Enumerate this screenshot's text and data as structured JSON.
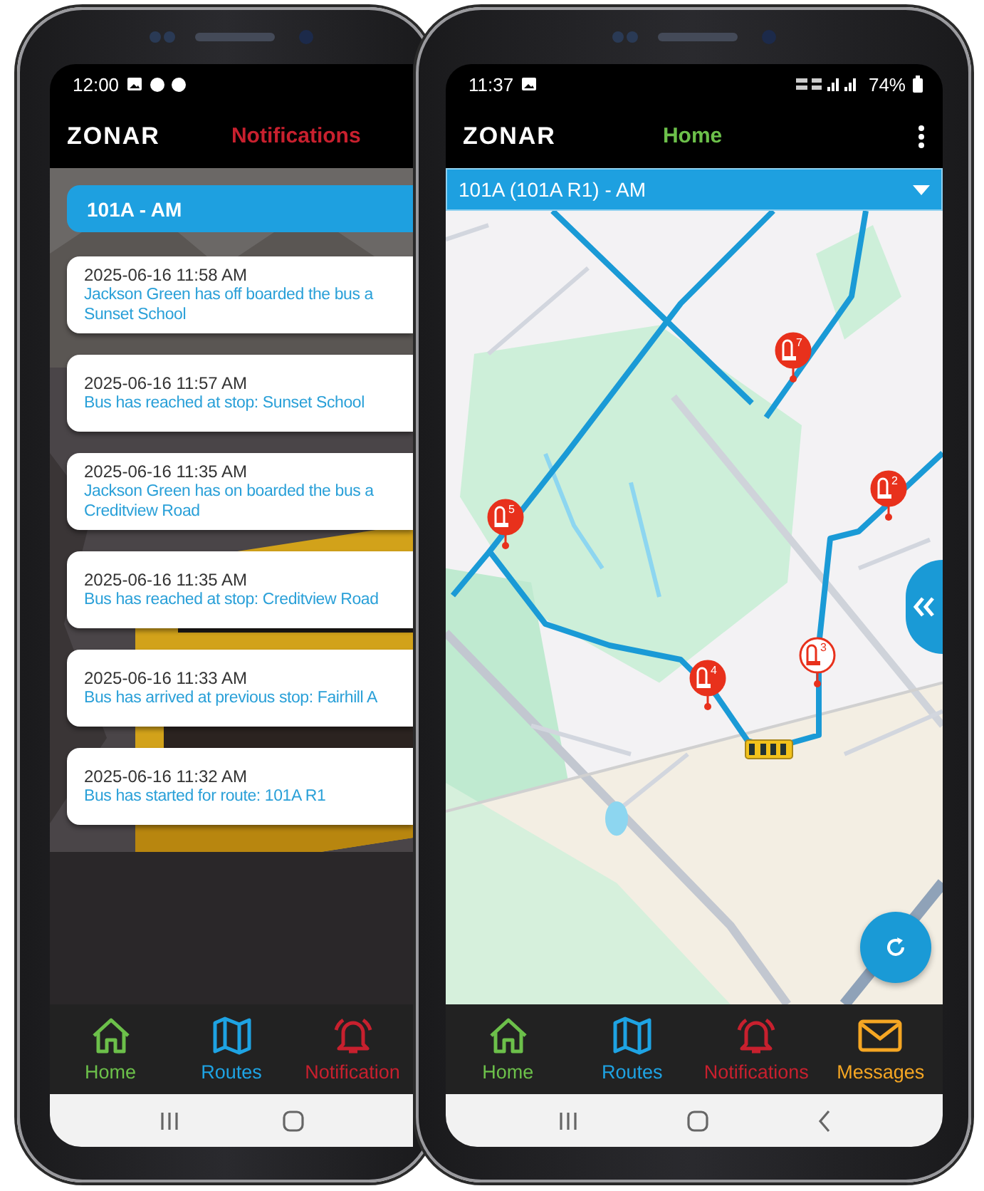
{
  "notifications_phone": {
    "status_bar": {
      "time": "12:00"
    },
    "app_bar": {
      "logo": "ZONAR",
      "title": "Notifications"
    },
    "route_header": "101A - AM",
    "notifications": [
      {
        "time": "2025-06-16 11:58 AM",
        "message": "Jackson Green has off boarded the bus a Sunset School"
      },
      {
        "time": "2025-06-16 11:57 AM",
        "message": "Bus has reached at stop: Sunset School"
      },
      {
        "time": "2025-06-16 11:35 AM",
        "message": "Jackson Green has on boarded the bus a Creditview Road"
      },
      {
        "time": "2025-06-16 11:35 AM",
        "message": "Bus has reached at stop: Creditview Road"
      },
      {
        "time": "2025-06-16 11:33 AM",
        "message": "Bus has arrived at previous stop: Fairhill A"
      },
      {
        "time": "2025-06-16 11:32 AM",
        "message": "Bus has started for route: 101A R1"
      }
    ],
    "bottom_nav": [
      {
        "label": "Home",
        "kind": "home",
        "color": "#6cc04a"
      },
      {
        "label": "Routes",
        "kind": "map",
        "color": "#1ea3e3"
      },
      {
        "label": "Notification",
        "kind": "bell",
        "color": "#c8202e"
      }
    ]
  },
  "home_phone": {
    "status_bar": {
      "time": "11:37",
      "battery": "74%"
    },
    "app_bar": {
      "logo": "ZONAR",
      "title": "Home"
    },
    "route_selector": "101A (101A R1) - AM",
    "map": {
      "kind": "picture",
      "stops": [
        {
          "label": "7",
          "kind": "filled"
        },
        {
          "label": "5",
          "kind": "filled"
        },
        {
          "label": "2",
          "kind": "filled"
        },
        {
          "label": "4",
          "kind": "filled"
        },
        {
          "label": "3",
          "kind": "outline"
        }
      ]
    },
    "bottom_nav": [
      {
        "label": "Home",
        "kind": "home",
        "color": "#6cc04a"
      },
      {
        "label": "Routes",
        "kind": "map",
        "color": "#1ea3e3"
      },
      {
        "label": "Notifications",
        "kind": "bell",
        "color": "#c8202e"
      },
      {
        "label": "Messages",
        "kind": "mail",
        "color": "#f5a623"
      }
    ]
  }
}
